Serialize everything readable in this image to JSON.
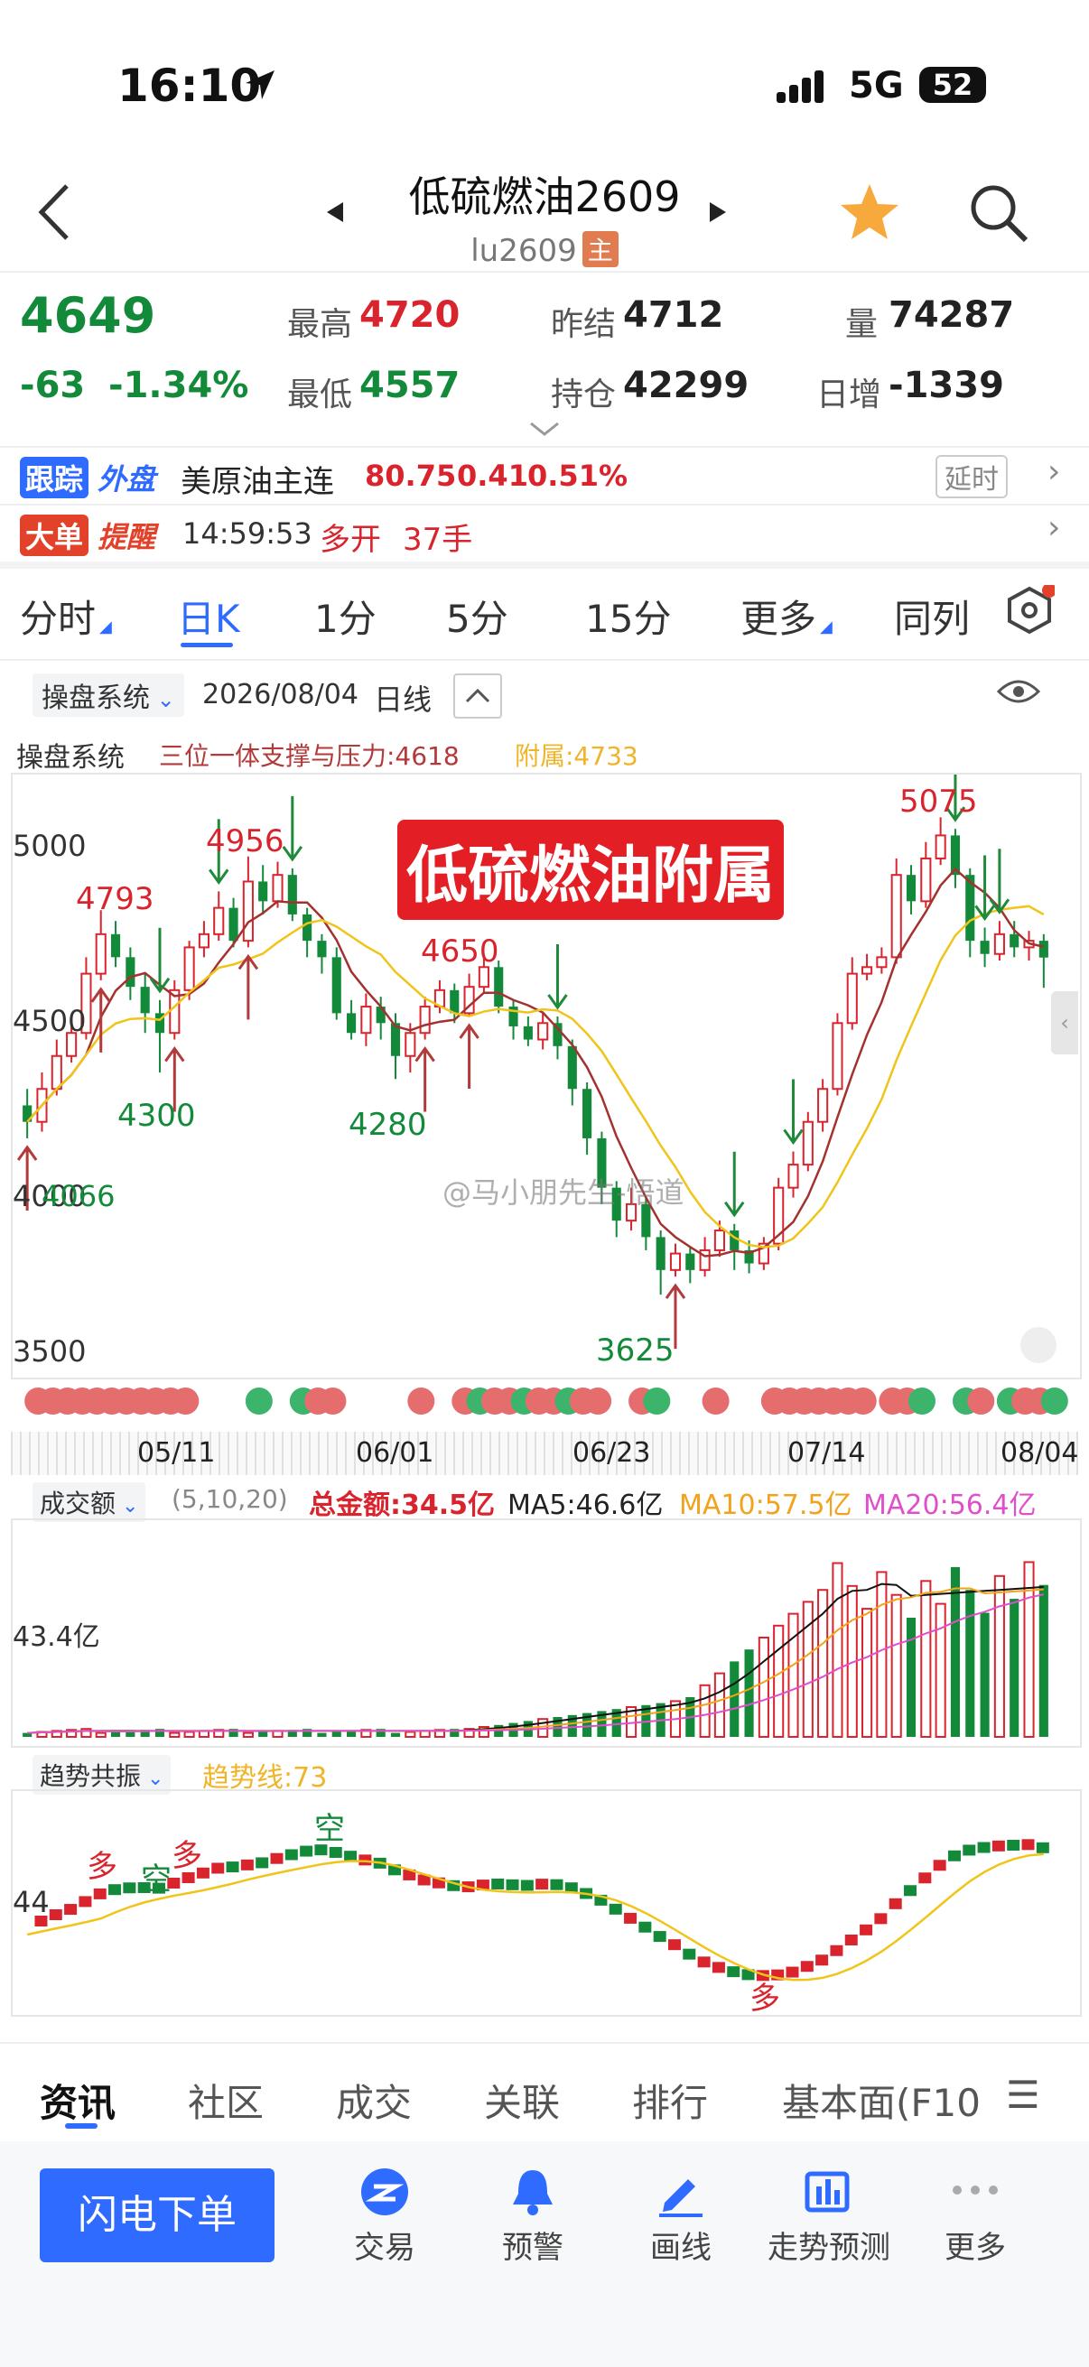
{
  "status": {
    "time": "16:10",
    "network": "5G",
    "battery": "52"
  },
  "header": {
    "title": "低硫燃油2609",
    "code": "lu2609",
    "main_tag": "主"
  },
  "quote": {
    "price": "4649",
    "change": "-63",
    "change_pct": "-1.34%",
    "high_label": "最高",
    "high": "4720",
    "low_label": "最低",
    "low": "4557",
    "prev_settle_label": "昨结",
    "prev_settle": "4712",
    "oi_label": "持仓",
    "oi": "42299",
    "volume_label": "量",
    "volume": "74287",
    "daily_inc_label": "日增",
    "daily_inc": "-1339"
  },
  "foreign": {
    "badge1": "跟踪",
    "badge2": "外盘",
    "name": "美原油主连",
    "price": "80.75",
    "change": "0.41",
    "pct": "0.51%",
    "delay": "延时"
  },
  "bigorder": {
    "badge1": "大单",
    "badge2": "提醒",
    "time": "14:59:53",
    "action": "多开",
    "qty": "37手"
  },
  "tabs": [
    "分时",
    "日K",
    "1分",
    "5分",
    "15分",
    "更多",
    "同列"
  ],
  "indicator": {
    "system": "操盘系统",
    "date": "2026/08/04",
    "period": "日线",
    "line_label": "操盘系统",
    "sr_label": "三位一体支撑与压力:4618",
    "attach_label": "附属:4733"
  },
  "chart_data": {
    "type": "candlestick",
    "title": "低硫燃油附属",
    "y_ticks": [
      "5000",
      "4500",
      "4000",
      "3500"
    ],
    "x_ticks": [
      "05/11",
      "06/01",
      "06/23",
      "07/14",
      "08/04"
    ],
    "annotations": [
      "4793",
      "4956",
      "4650",
      "5075",
      "4300",
      "4280",
      "4066",
      "3625"
    ],
    "watermark": "@马小朋先生-悟道",
    "candles": [
      [
        4200,
        4150,
        4250,
        4100
      ],
      [
        4150,
        4250,
        4300,
        4120
      ],
      [
        4250,
        4350,
        4400,
        4230
      ],
      [
        4350,
        4420,
        4470,
        4330
      ],
      [
        4420,
        4600,
        4650,
        4400
      ],
      [
        4600,
        4720,
        4793,
        4580
      ],
      [
        4720,
        4650,
        4760,
        4620
      ],
      [
        4650,
        4560,
        4680,
        4520
      ],
      [
        4560,
        4480,
        4600,
        4420
      ],
      [
        4480,
        4420,
        4520,
        4300
      ],
      [
        4420,
        4550,
        4580,
        4400
      ],
      [
        4550,
        4680,
        4700,
        4520
      ],
      [
        4680,
        4720,
        4760,
        4650
      ],
      [
        4720,
        4800,
        4850,
        4700
      ],
      [
        4800,
        4700,
        4830,
        4680
      ],
      [
        4700,
        4880,
        4956,
        4680
      ],
      [
        4880,
        4820,
        4930,
        4780
      ],
      [
        4820,
        4900,
        4940,
        4800
      ],
      [
        4900,
        4780,
        4920,
        4760
      ],
      [
        4780,
        4700,
        4800,
        4650
      ],
      [
        4700,
        4650,
        4720,
        4600
      ],
      [
        4650,
        4480,
        4680,
        4460
      ],
      [
        4480,
        4420,
        4520,
        4400
      ],
      [
        4420,
        4500,
        4540,
        4380
      ],
      [
        4500,
        4450,
        4530,
        4400
      ],
      [
        4450,
        4350,
        4480,
        4280
      ],
      [
        4350,
        4420,
        4450,
        4300
      ],
      [
        4420,
        4500,
        4530,
        4400
      ],
      [
        4500,
        4550,
        4580,
        4480
      ],
      [
        4550,
        4480,
        4570,
        4450
      ],
      [
        4480,
        4560,
        4600,
        4470
      ],
      [
        4560,
        4620,
        4650,
        4540
      ],
      [
        4620,
        4500,
        4640,
        4480
      ],
      [
        4500,
        4440,
        4520,
        4400
      ],
      [
        4440,
        4400,
        4470,
        4380
      ],
      [
        4400,
        4450,
        4480,
        4370
      ],
      [
        4450,
        4380,
        4470,
        4340
      ],
      [
        4380,
        4250,
        4400,
        4200
      ],
      [
        4250,
        4100,
        4270,
        4050
      ],
      [
        4100,
        3950,
        4120,
        3900
      ],
      [
        3950,
        3850,
        3970,
        3800
      ],
      [
        3850,
        3900,
        3950,
        3820
      ],
      [
        3900,
        3800,
        3920,
        3760
      ],
      [
        3800,
        3700,
        3820,
        3625
      ],
      [
        3700,
        3750,
        3780,
        3680
      ],
      [
        3750,
        3700,
        3770,
        3660
      ],
      [
        3700,
        3760,
        3800,
        3680
      ],
      [
        3760,
        3820,
        3850,
        3740
      ],
      [
        3820,
        3760,
        3840,
        3700
      ],
      [
        3760,
        3720,
        3790,
        3690
      ],
      [
        3720,
        3780,
        3800,
        3700
      ],
      [
        3780,
        3950,
        3980,
        3760
      ],
      [
        3950,
        4020,
        4060,
        3920
      ],
      [
        4020,
        4150,
        4180,
        4000
      ],
      [
        4150,
        4250,
        4280,
        4120
      ],
      [
        4250,
        4450,
        4480,
        4230
      ],
      [
        4450,
        4600,
        4650,
        4430
      ],
      [
        4600,
        4620,
        4660,
        4580
      ],
      [
        4620,
        4650,
        4680,
        4600
      ],
      [
        4650,
        4900,
        4950,
        4630
      ],
      [
        4900,
        4820,
        4930,
        4780
      ],
      [
        4820,
        4950,
        5000,
        4800
      ],
      [
        4950,
        5020,
        5075,
        4930
      ],
      [
        5020,
        4900,
        5040,
        4860
      ],
      [
        4900,
        4700,
        4920,
        4650
      ],
      [
        4700,
        4660,
        4740,
        4620
      ],
      [
        4660,
        4720,
        4760,
        4640
      ],
      [
        4720,
        4680,
        4760,
        4650
      ],
      [
        4680,
        4700,
        4730,
        4640
      ],
      [
        4700,
        4649,
        4720,
        4557
      ]
    ]
  },
  "volume": {
    "name": "成交额",
    "params": "(5,10,20)",
    "total": "总金额:34.5亿",
    "ma5": "MA5:46.6亿",
    "ma10": "MA10:57.5亿",
    "ma20": "MA20:56.4亿",
    "axis": "43.4亿"
  },
  "trend": {
    "name": "趋势共振",
    "line": "趋势线:73",
    "axis": "44",
    "labels": [
      "多",
      "空",
      "多",
      "空",
      "多"
    ]
  },
  "bottom_tabs": [
    "资讯",
    "社区",
    "成交",
    "关联",
    "排行",
    "基本面(F10",
    "☰"
  ],
  "action": {
    "flash": "闪电下单",
    "items": [
      "交易",
      "预警",
      "画线",
      "走势预测",
      "更多"
    ]
  },
  "colors": {
    "up": "#d9232d",
    "down": "#138a3a",
    "accent": "#2f6bff",
    "ma5": "#111111",
    "ma10": "#f2a21b",
    "ma20": "#e04fcb"
  }
}
